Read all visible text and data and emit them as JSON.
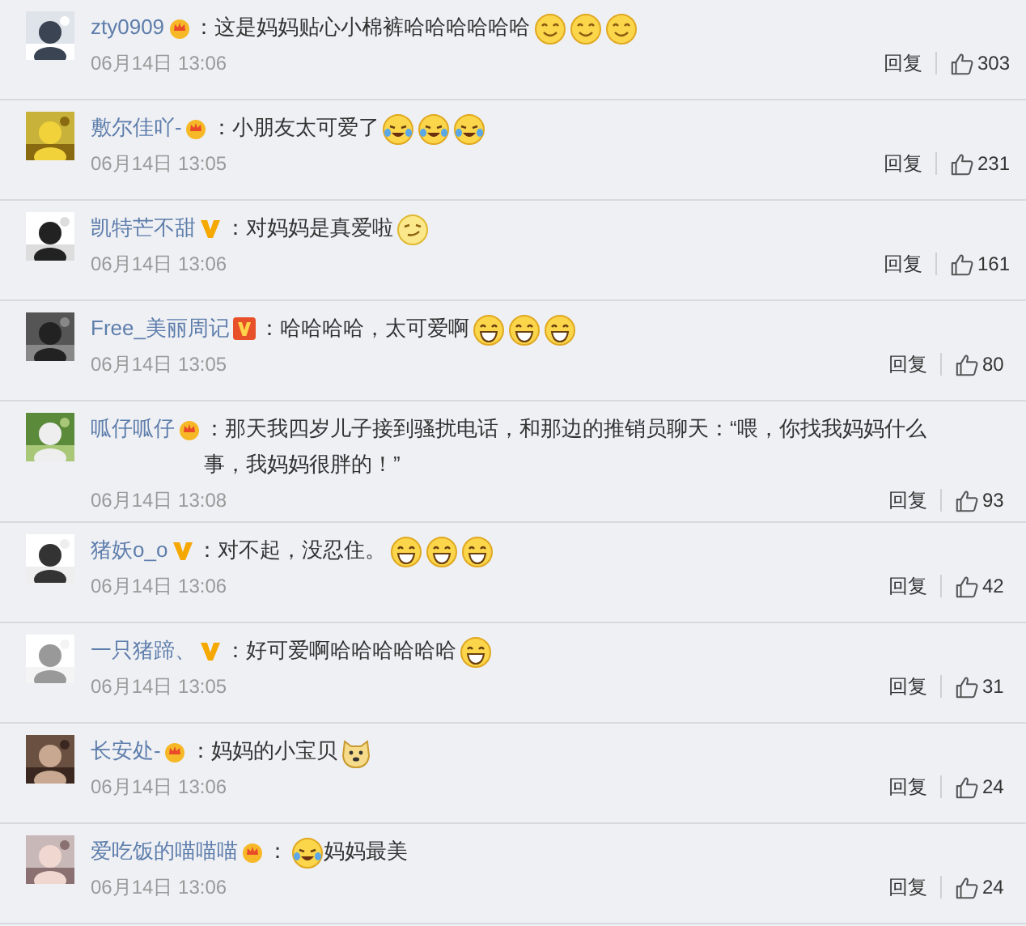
{
  "comments": [
    {
      "user": "zty0909",
      "badge": {
        "kind": "crown"
      },
      "text": "：这是妈妈贴心小棉裤哈哈哈哈哈哈",
      "emojis": [
        {
          "kind": "smile"
        },
        {
          "kind": "smile"
        },
        {
          "kind": "smile"
        }
      ],
      "time": "06月14日 13:06",
      "reply": "回复",
      "likes": "303"
    },
    {
      "user": "敷尔佳吖-",
      "badge": {
        "kind": "crown"
      },
      "text": "：小朋友太可爱了",
      "emojis": [
        {
          "kind": "cry-laugh"
        },
        {
          "kind": "cry-laugh"
        },
        {
          "kind": "cry-laugh"
        }
      ],
      "time": "06月14日 13:05",
      "reply": "回复",
      "likes": "231"
    },
    {
      "user": "凯特芒不甜",
      "badge": {
        "kind": "v"
      },
      "text": "：对妈妈是真爱啦",
      "emojis": [
        {
          "kind": "sly"
        }
      ],
      "time": "06月14日 13:06",
      "reply": "回复",
      "likes": "161"
    },
    {
      "user": "Free_美丽周记",
      "badge": {
        "kind": "v-box"
      },
      "text": "：哈哈哈哈，太可爱啊",
      "emojis": [
        {
          "kind": "laugh"
        },
        {
          "kind": "laugh"
        },
        {
          "kind": "laugh"
        }
      ],
      "time": "06月14日 13:05",
      "reply": "回复",
      "likes": "80"
    },
    {
      "user": "呱仔呱仔",
      "badge": {
        "kind": "crown"
      },
      "text": "：那天我四岁儿子接到骚扰电话，和那边的推销员聊天：“喂，你找我妈妈什么事，我妈妈很胖的！”",
      "time": "06月14日 13:08",
      "reply": "回复",
      "likes": "93"
    },
    {
      "user": "猪妖o_o",
      "badge": {
        "kind": "v"
      },
      "text": "：对不起，没忍住。",
      "emojis": [
        {
          "kind": "laugh"
        },
        {
          "kind": "laugh"
        },
        {
          "kind": "laugh"
        }
      ],
      "time": "06月14日 13:06",
      "reply": "回复",
      "likes": "42"
    },
    {
      "user": "一只猪蹄、",
      "badge": {
        "kind": "v"
      },
      "text": "：好可爱啊哈哈哈哈哈哈",
      "emojis": [
        {
          "kind": "laugh"
        }
      ],
      "time": "06月14日 13:05",
      "reply": "回复",
      "likes": "31"
    },
    {
      "user": "长安处-",
      "badge": {
        "kind": "crown"
      },
      "text": "：妈妈的小宝贝",
      "emojis": [
        {
          "kind": "doge"
        }
      ],
      "time": "06月14日 13:06",
      "reply": "回复",
      "likes": "24"
    },
    {
      "user": "爱吃饭的喵喵喵",
      "badge": {
        "kind": "crown"
      },
      "text": "：",
      "emojis": [
        {
          "kind": "cry-laugh"
        }
      ],
      "text_after": "妈妈最美",
      "time": "06月14日 13:06",
      "reply": "回复",
      "likes": "24"
    }
  ]
}
